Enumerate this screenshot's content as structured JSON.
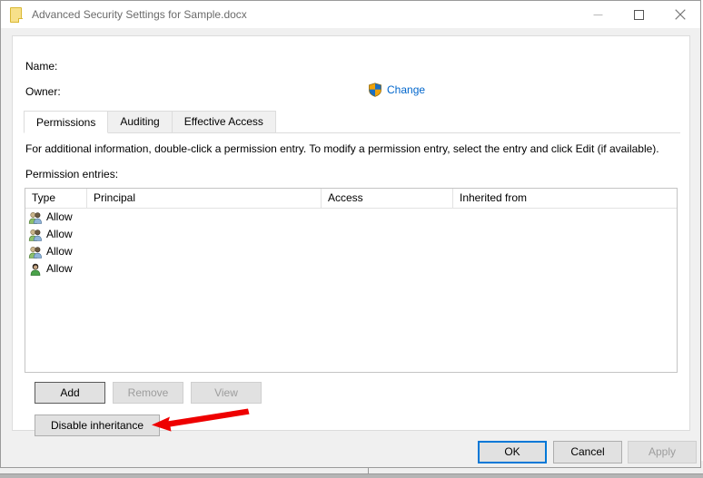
{
  "window": {
    "title": "Advanced Security Settings for Sample.docx",
    "icon": "document-icon",
    "minimize_label": "—",
    "maximize_label": "□",
    "close_label": "✕"
  },
  "header": {
    "name_label": "Name:",
    "name_value": "",
    "owner_label": "Owner:",
    "owner_value": "",
    "change_link": "Change",
    "change_icon": "uac-shield-icon"
  },
  "tabs": [
    {
      "label": "Permissions",
      "active": true
    },
    {
      "label": "Auditing",
      "active": false
    },
    {
      "label": "Effective Access",
      "active": false
    }
  ],
  "main": {
    "info_text": "For additional information, double-click a permission entry. To modify a permission entry, select the entry and click Edit (if available).",
    "entries_label": "Permission entries:"
  },
  "table": {
    "columns": [
      "Type",
      "Principal",
      "Access",
      "Inherited from"
    ],
    "rows": [
      {
        "icon": "group-icon",
        "type": "Allow",
        "principal": "",
        "access": "",
        "inherited_from": ""
      },
      {
        "icon": "group-icon",
        "type": "Allow",
        "principal": "",
        "access": "",
        "inherited_from": ""
      },
      {
        "icon": "group-icon",
        "type": "Allow",
        "principal": "",
        "access": "",
        "inherited_from": ""
      },
      {
        "icon": "user-icon",
        "type": "Allow",
        "principal": "",
        "access": "",
        "inherited_from": ""
      }
    ]
  },
  "actions": {
    "add": "Add",
    "remove": "Remove",
    "view": "View",
    "disable_inheritance": "Disable inheritance"
  },
  "footer": {
    "ok": "OK",
    "cancel": "Cancel",
    "apply": "Apply"
  },
  "annotation": {
    "type": "arrow",
    "color": "#ee0000",
    "points_to": "disable-inheritance-button"
  },
  "colors": {
    "accent": "#0078d7",
    "link": "#0066cc",
    "annotation_red": "#ee0000",
    "dialog_background": "#f0f0f0",
    "client_background": "#ffffff",
    "disabled_text": "#9d9d9d",
    "title_text": "#6b6b6b"
  }
}
